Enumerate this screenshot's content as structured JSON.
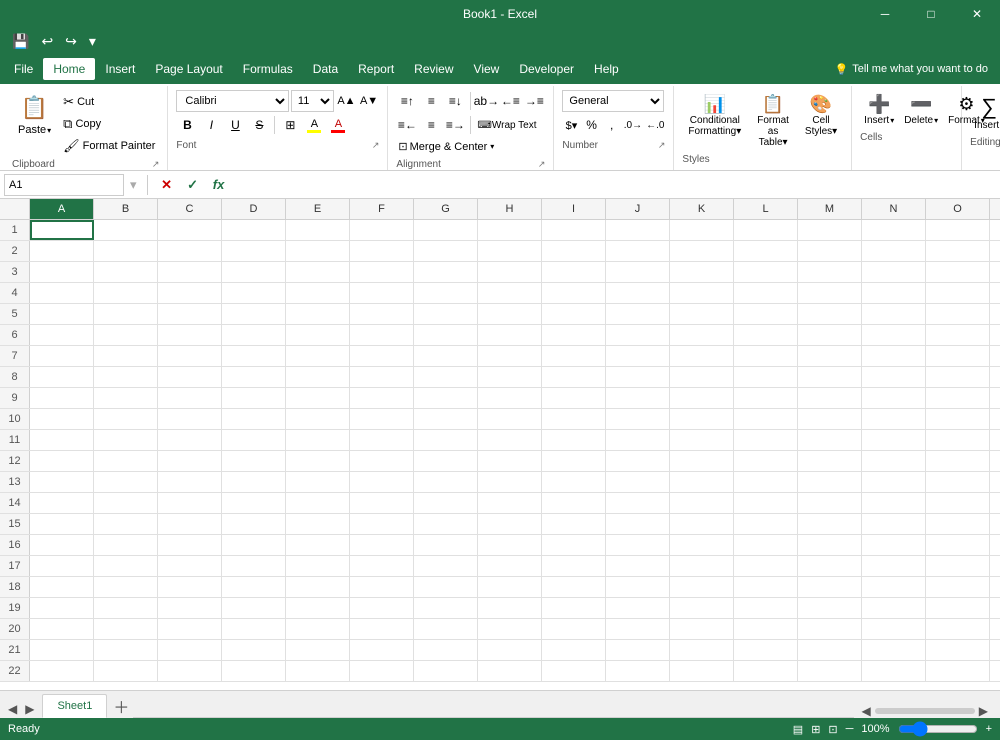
{
  "titleBar": {
    "title": "Book1 - Excel",
    "minimize": "─",
    "maximize": "□",
    "close": "✕"
  },
  "menuBar": {
    "items": [
      "File",
      "Home",
      "Insert",
      "Page Layout",
      "Formulas",
      "Data",
      "Report",
      "Review",
      "View",
      "Developer",
      "Help"
    ]
  },
  "quickAccess": {
    "save": "💾",
    "undo": "↩",
    "redo": "↪",
    "customize": "▾"
  },
  "ribbon": {
    "clipboard": {
      "label": "Clipboard",
      "paste": "Paste",
      "cut": "Cut",
      "copy": "Copy",
      "formatPainter": "Format Painter"
    },
    "font": {
      "label": "Font",
      "fontName": "Calibri",
      "fontSize": "11",
      "bold": "B",
      "italic": "I",
      "underline": "U",
      "strikethrough": "S",
      "borders": "⊞",
      "fillColor": "A",
      "fontColor": "A"
    },
    "alignment": {
      "label": "Alignment",
      "wrapText": "Wrap Text",
      "mergeCenter": "Merge & Center"
    },
    "number": {
      "label": "Number",
      "format": "General"
    },
    "styles": {
      "label": "Styles",
      "conditionalFormatting": "Conditional Formatting▾",
      "formatAsTable": "Format as Table▾",
      "cellStyles": "Cell Styles▾"
    },
    "cells": {
      "label": "Cells",
      "insert": "Insert",
      "delete": "Delete",
      "format": "Format"
    },
    "insert": {
      "label": "Insert",
      "name": "Insert"
    },
    "tellMe": "Tell me what you want to do"
  },
  "formulaBar": {
    "nameBox": "A1",
    "cancelBtn": "✕",
    "confirmBtn": "✓",
    "functionBtn": "fx",
    "formula": ""
  },
  "grid": {
    "columns": [
      "A",
      "B",
      "C",
      "D",
      "E",
      "F",
      "G",
      "H",
      "I",
      "J",
      "K",
      "L",
      "M",
      "N",
      "O"
    ],
    "rows": 22,
    "selectedCell": "A1"
  },
  "sheets": {
    "active": "Sheet1",
    "tabs": [
      "Sheet1"
    ]
  },
  "statusBar": {
    "ready": "Ready",
    "zoom": "100%"
  }
}
